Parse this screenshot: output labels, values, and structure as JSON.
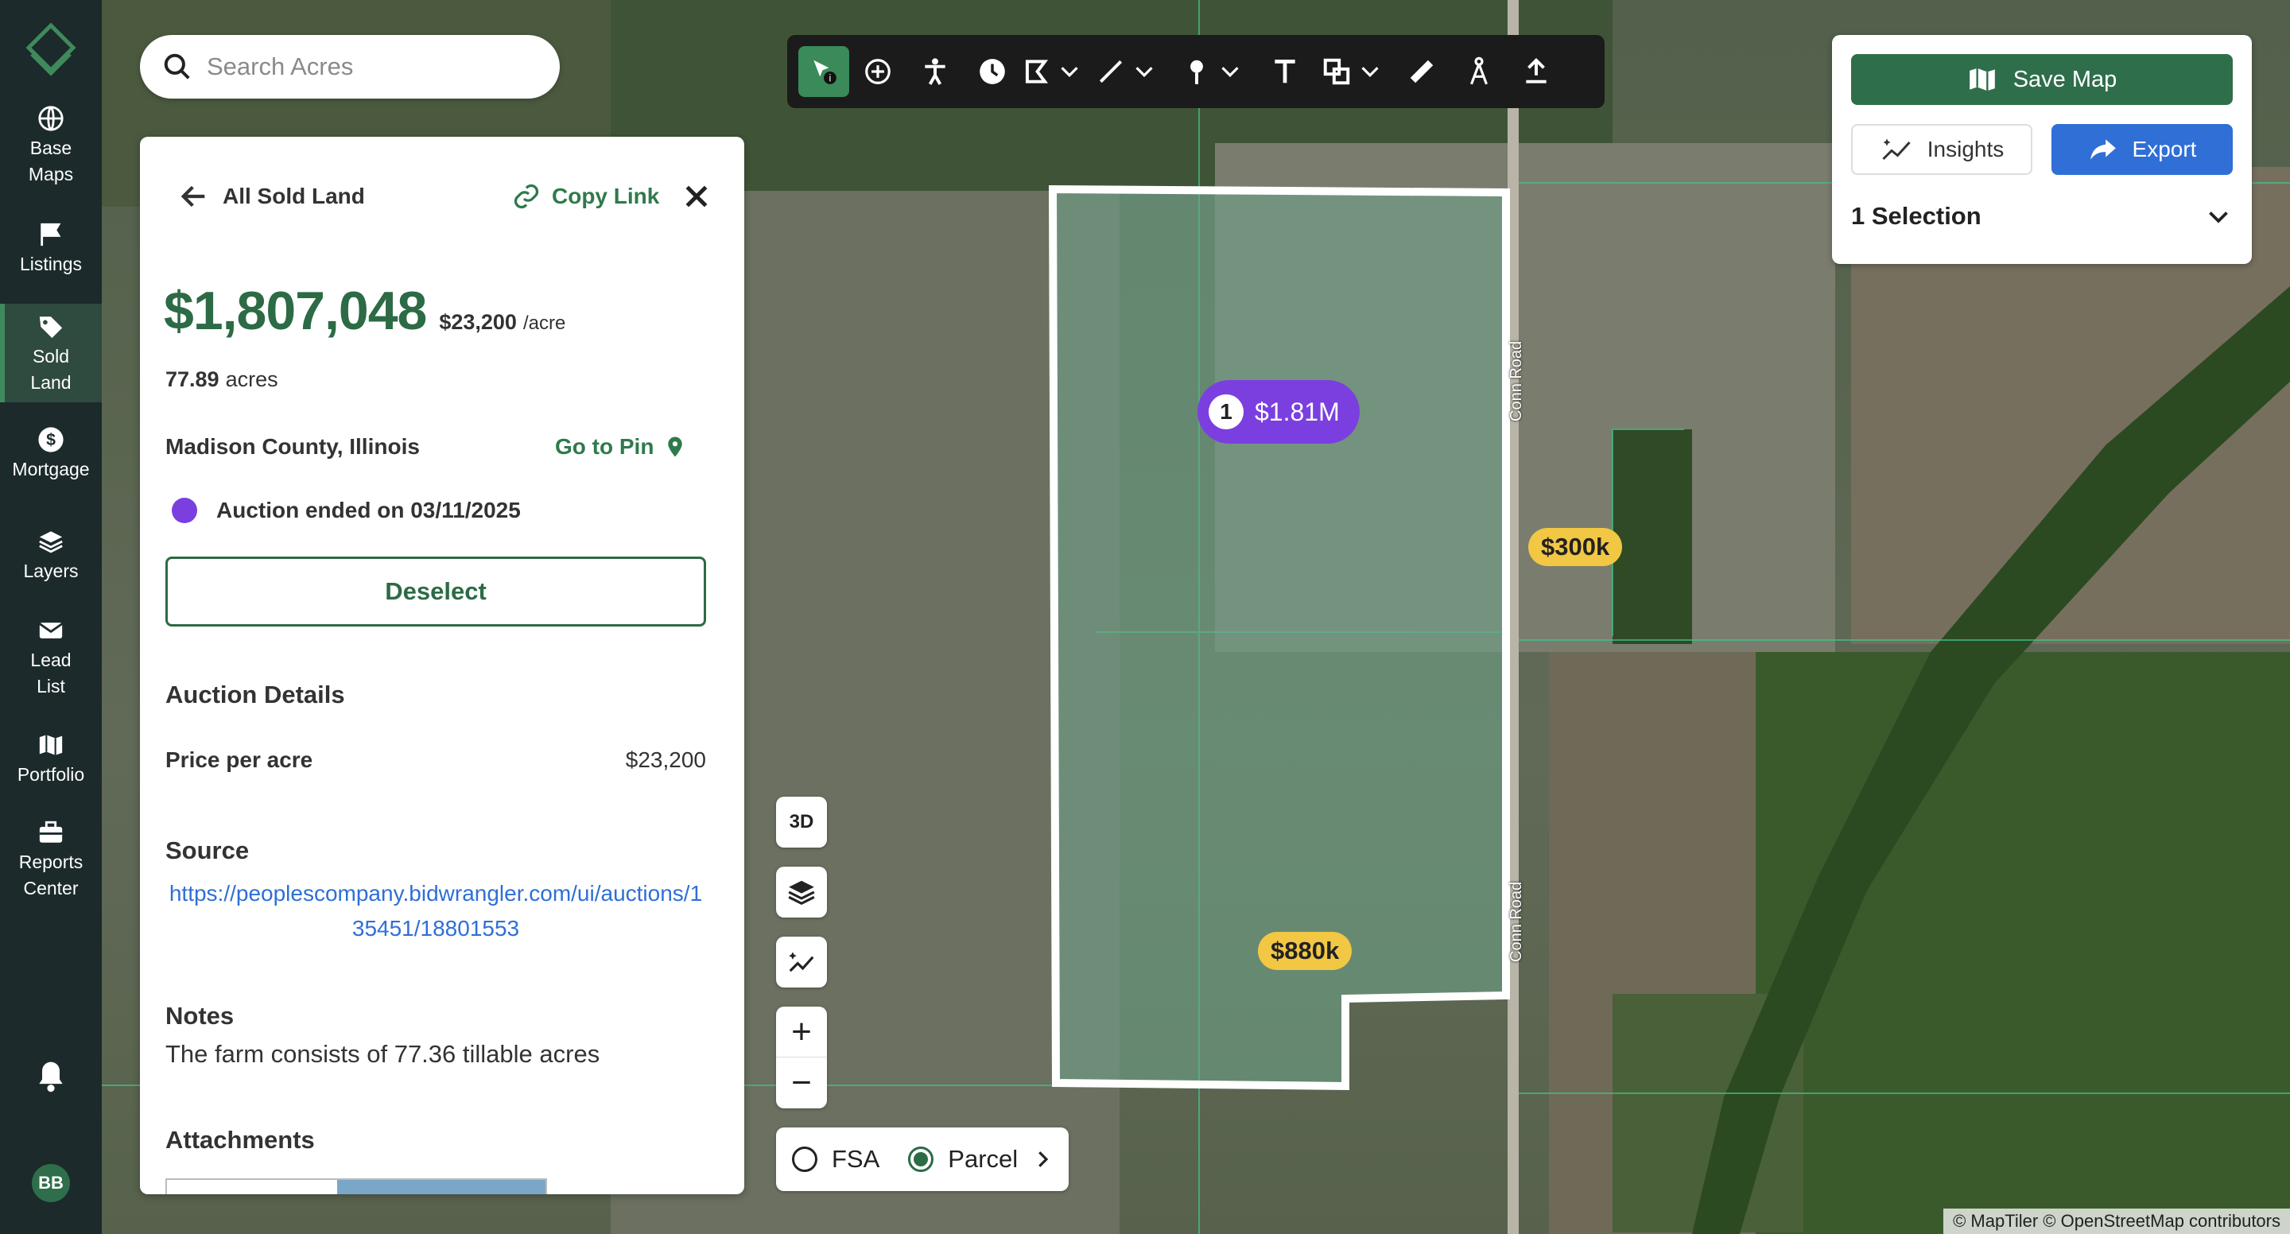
{
  "sidebar": {
    "items": [
      {
        "label": "Base\nMaps",
        "icon": "globe-icon"
      },
      {
        "label": "Listings",
        "icon": "flag-icon"
      },
      {
        "label": "Sold\nLand",
        "icon": "tag-icon",
        "active": true
      },
      {
        "label": "Mortgage",
        "icon": "dollar-icon"
      },
      {
        "label": "Layers",
        "icon": "layers-icon"
      },
      {
        "label": "Lead\nList",
        "icon": "mail-icon"
      },
      {
        "label": "Portfolio",
        "icon": "map-icon"
      },
      {
        "label": "Reports\nCenter",
        "icon": "briefcase-icon"
      }
    ],
    "avatar_initials": "BB"
  },
  "search": {
    "placeholder": "Search Acres"
  },
  "panel": {
    "back_label": "All Sold Land",
    "copy_link_label": "Copy Link",
    "price": "$1,807,048",
    "price_per_acre": "$23,200",
    "per_acre_unit": "/acre",
    "acres_value": "77.89",
    "acres_unit": "acres",
    "county": "Madison County, Illinois",
    "go_to_pin_label": "Go to Pin",
    "auction_status": "Auction ended on 03/11/2025",
    "status_color": "#7b3fe0",
    "deselect_label": "Deselect",
    "auction_details_title": "Auction Details",
    "price_per_acre_label": "Price per acre",
    "price_per_acre_value": "$23,200",
    "source_title": "Source",
    "source_url": "https://peoplescompany.bidwrangler.com/ui/auctions/135451/18801553",
    "notes_title": "Notes",
    "notes_text": "The farm consists of 77.36 tillable acres",
    "attachments_title": "Attachments"
  },
  "map_controls": {
    "three_d_label": "3D",
    "layer_options": [
      {
        "label": "FSA",
        "selected": false
      },
      {
        "label": "Parcel",
        "selected": true
      }
    ]
  },
  "card": {
    "save_map_label": "Save Map",
    "insights_label": "Insights",
    "export_label": "Export",
    "selection_label": "1 Selection"
  },
  "map": {
    "selected_pin": {
      "number": "1",
      "price": "$1.81M"
    },
    "price_pins": [
      "$300k",
      "$880k"
    ],
    "road_label": "Conn Road",
    "attribution": "© MapTiler © OpenStreetMap contributors"
  },
  "colors": {
    "brand_green": "#2c6b45",
    "accent_blue": "#2f6fd6",
    "pin_purple": "#7b3fe0",
    "pin_yellow": "#f2c744"
  }
}
